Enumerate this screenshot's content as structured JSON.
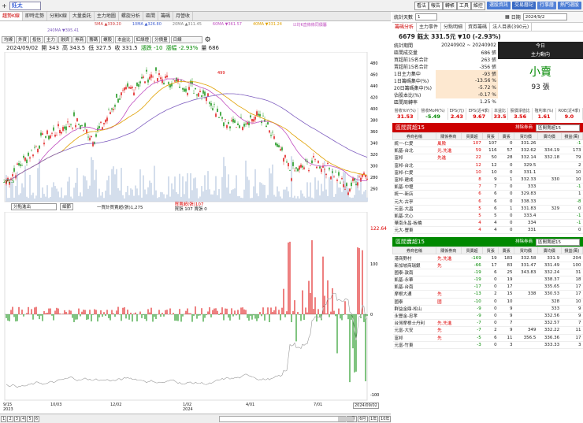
{
  "topbar": {
    "stock": "鈺太",
    "buttons": [
      "看法",
      "報告",
      "轉帳",
      "工具",
      "維控"
    ],
    "pills": [
      {
        "label": "選股資訊",
        "color": "#4a7bd4"
      },
      {
        "label": "交易曆記",
        "color": "#3a6bc4"
      },
      {
        "label": "行事曆",
        "color": "#5583d8"
      },
      {
        "label": "熱門選股",
        "color": "#4a7bd4"
      }
    ]
  },
  "tabs": [
    "趨勢K線",
    "即時走勢",
    "分割K線",
    "大量委託",
    "主力地圖",
    "螺旋分析",
    "區間",
    "籌碼",
    "月營收"
  ],
  "ma": [
    {
      "label": "5MA ▲339.20",
      "color": "#d04040"
    },
    {
      "label": "10MA ▲326.80",
      "color": "#4060d0"
    },
    {
      "label": "20MA ▲311.45",
      "color": "#808080"
    },
    {
      "label": "60MA ▼361.57",
      "color": "#c050c0"
    },
    {
      "label": "40MA ▼331.24",
      "color": "#e0a000"
    },
    {
      "label": "240MA ▼395.41",
      "color": "#8060c0"
    }
  ],
  "mabar_note": "☑均K直條條同價屬",
  "tools": [
    "均線",
    "外資",
    "投信",
    "主力",
    "融資",
    "券商",
    "籌碼",
    "螺股",
    "本益比",
    "紅綠燈",
    "分價量",
    "日線"
  ],
  "info": {
    "date": "2024/09/02",
    "open": "開 343",
    "high": "高 343.5",
    "low": "低 327.5",
    "close": "收 331.5",
    "change": "漲跌 -10",
    "pct": "漲幅 -2.93%",
    "vol": "量 686"
  },
  "chart": {
    "ymax": "499",
    "ymin": "271.5",
    "yticks": [
      "480",
      "460",
      "440",
      "420",
      "400",
      "380",
      "360",
      "340",
      "320",
      "300",
      "280",
      "260"
    ]
  },
  "panel2": {
    "select": "分點進出",
    "btn": "細節",
    "legend1": "一買計買賣超(張)1,275",
    "legend2": "買賣超(張)107",
    "legend3": "買張 107 賣張 0",
    "ymax": "122.64",
    "yticks": [
      "100",
      "0",
      "-100"
    ]
  },
  "xaxis": [
    "9/15\n2023",
    "10/03",
    "12/02",
    "1/02\n2024",
    "4/01",
    "7/01",
    "2024/09/02"
  ],
  "pages": [
    "1",
    "2",
    "3",
    "4",
    "5",
    "6"
  ],
  "periods": [
    "3月",
    "6月",
    "1年",
    "10年"
  ],
  "right": {
    "period_label": "統計天數",
    "period_val": "1",
    "date_label": "日期",
    "date_val": "2024/9/2",
    "tabs": [
      "籌碼分析",
      "主力事件",
      "分點明細",
      "資券籌碼",
      "法人目表(390元)"
    ],
    "stock_line": "6679 鈺太  331.5元 ▼10 (-2.93%)",
    "stats": [
      [
        "統計期間",
        "20240902 ~ 20240902"
      ],
      [
        "區間成交量",
        "686 張"
      ],
      [
        "買超前15名合計",
        "263 張"
      ],
      [
        "賣超前15名合計",
        "-356 張"
      ],
      [
        "1日主力集中",
        "-93 張"
      ],
      [
        "1日籌碼集中(%)",
        "-13.56 %"
      ],
      [
        "20日籌碼集中(%)",
        "-5.72 %"
      ],
      [
        "佔股本比(%)",
        "-0.17 %"
      ],
      [
        "區間周轉率",
        "1.25 %"
      ]
    ],
    "today": "今日",
    "main": "主力動向",
    "verdict": "小賣",
    "verdict_qty": "93 張",
    "fin_h": [
      "營收YoY(%)",
      "營收MoM(%)",
      "EPS(元)",
      "EPS(近4季)",
      "本益比",
      "股價淨值比",
      "殖利率(%)",
      "ROE(近4季)"
    ],
    "fin_v": [
      "31.53",
      "-5.49",
      "2.43",
      "9.67",
      "33.5",
      "3.56",
      "1.61",
      "9.0"
    ],
    "buy_title": "區間買超15",
    "sell_title": "區間賣超15",
    "sort": "排除券商",
    "sort2": "區間賣超15",
    "cols": [
      "券商名稱",
      "關係券商",
      "買賣超",
      "買張",
      "賣張",
      "買均價",
      "賣均價",
      "損益(萬)"
    ],
    "buy": [
      [
        "統一-仁愛",
        "風險",
        "107",
        "107",
        "0",
        "331.26",
        "",
        "-1"
      ],
      [
        "凱基-台北",
        "光.先進",
        "59",
        "116",
        "57",
        "332.62",
        "334.19",
        "173"
      ],
      [
        "富邦",
        "先進",
        "22",
        "50",
        "28",
        "332.14",
        "332.18",
        "79"
      ],
      [
        "富邦-台北",
        "",
        "12",
        "12",
        "0",
        "329.5",
        "",
        "2"
      ],
      [
        "富邦-仁愛",
        "",
        "10",
        "10",
        "0",
        "331.1",
        "",
        "10"
      ],
      [
        "富邦-建成",
        "",
        "8",
        "9",
        "1",
        "332.33",
        "330",
        "10"
      ],
      [
        "凱基-中壢",
        "",
        "7",
        "7",
        "0",
        "333",
        "",
        "-1"
      ],
      [
        "統一-新店",
        "",
        "6",
        "6",
        "0",
        "329.83",
        "",
        "1"
      ],
      [
        "元大-古亭",
        "",
        "6",
        "6",
        "0",
        "338.33",
        "",
        "-8"
      ],
      [
        "元富-大昌",
        "",
        "5",
        "6",
        "1",
        "331.83",
        "329",
        "0"
      ],
      [
        "凱基-文心",
        "",
        "5",
        "5",
        "0",
        "333.4",
        "",
        "-1"
      ],
      [
        "華南永昌-板橋",
        "",
        "4",
        "4",
        "0",
        "334",
        "",
        "-1"
      ],
      [
        "元大-豐東",
        "",
        "4",
        "4",
        "0",
        "331",
        "",
        "0"
      ]
    ],
    "sell": [
      [
        "港商野村",
        "先.先進",
        "-169",
        "19",
        "183",
        "332.58",
        "331.9",
        "204"
      ],
      [
        "新加坡商瑞銀",
        "先",
        "-66",
        "17",
        "83",
        "331.47",
        "331.49",
        "100"
      ],
      [
        "國泰-敦南",
        "",
        "-19",
        "6",
        "25",
        "343.83",
        "332.24",
        "31"
      ],
      [
        "凱基-永華",
        "",
        "-19",
        "0",
        "19",
        "",
        "338.37",
        "18"
      ],
      [
        "凱基-台南",
        "",
        "-17",
        "0",
        "17",
        "",
        "335.65",
        "17"
      ],
      [
        "摩根大通",
        "先",
        "-13",
        "2",
        "15",
        "338",
        "330.53",
        "17"
      ],
      [
        "國泰",
        "國",
        "-10",
        "0",
        "10",
        "",
        "328",
        "10"
      ],
      [
        "群益金鼎-松山",
        "",
        "-9",
        "0",
        "9",
        "",
        "333",
        "9"
      ],
      [
        "永豐金-忠孝",
        "",
        "-9",
        "0",
        "9",
        "",
        "332.56",
        "9"
      ],
      [
        "台灣摩根士丹利",
        "先.先進",
        "-7",
        "0",
        "7",
        "",
        "332.57",
        "7"
      ],
      [
        "元富-大安",
        "先",
        "-7",
        "2",
        "9",
        "349",
        "332.22",
        "11"
      ],
      [
        "富邦",
        "先",
        "-5",
        "6",
        "11",
        "356.5",
        "336.36",
        "17"
      ],
      [
        "元富-竹東",
        "",
        "-3",
        "0",
        "3",
        "",
        "333.33",
        "3"
      ]
    ]
  }
}
